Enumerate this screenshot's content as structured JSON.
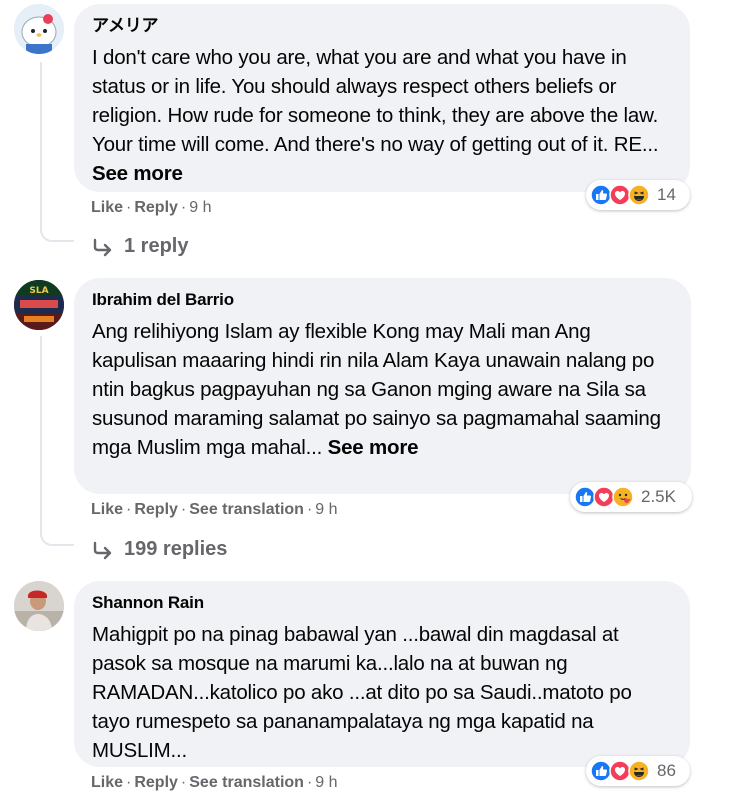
{
  "comments": [
    {
      "author": "アメリア",
      "text": "I don't care who you are, what you are and what you have in status or in life. You should always respect others beliefs or religion. How rude for someone to think, they are above the law. Your time will come. And there's no way of getting out of it. RE...",
      "see_more": "See more",
      "actions": {
        "like": "Like",
        "reply": "Reply",
        "time": "9 h"
      },
      "reaction_count": "14",
      "replies": "1 reply"
    },
    {
      "author": "Ibrahim del Barrio",
      "text": "Ang relihiyong Islam ay flexible Kong may Mali man Ang kapulisan maaaring hindi rin nila Alam Kaya unawain nalang po ntin bagkus pagpayuhan ng sa Ganon mging aware na Sila sa susunod maraming salamat po sainyo sa pagmamahal saaming mga Muslim mga mahal...",
      "see_more": "See more",
      "avatar_text": "SLA",
      "actions": {
        "like": "Like",
        "reply": "Reply",
        "translate": "See translation",
        "time": "9 h"
      },
      "reaction_count": "2.5K",
      "replies": "199 replies"
    },
    {
      "author": "Shannon Rain",
      "text": "Mahigpit po na pinag babawal yan ...bawal din magdasal at pasok sa mosque na marumi ka...lalo na at buwan ng RAMADAN...katolico po ako ...at dito po sa Saudi..matoto po tayo rumespeto sa pananampalataya ng mga kapatid na MUSLIM...",
      "actions": {
        "like": "Like",
        "reply": "Reply",
        "translate": "See translation",
        "time": "9 h"
      },
      "reaction_count": "86"
    }
  ],
  "colors": {
    "bubble": "#f0f2f5",
    "secondary_text": "#65676b",
    "like_blue": "#1877f2",
    "love_red": "#f33e58",
    "haha_yellow": "#f7b125"
  },
  "icons": [
    "like-reaction-icon",
    "love-reaction-icon",
    "haha-reaction-icon",
    "care-reaction-icon",
    "reply-arrow-icon"
  ]
}
